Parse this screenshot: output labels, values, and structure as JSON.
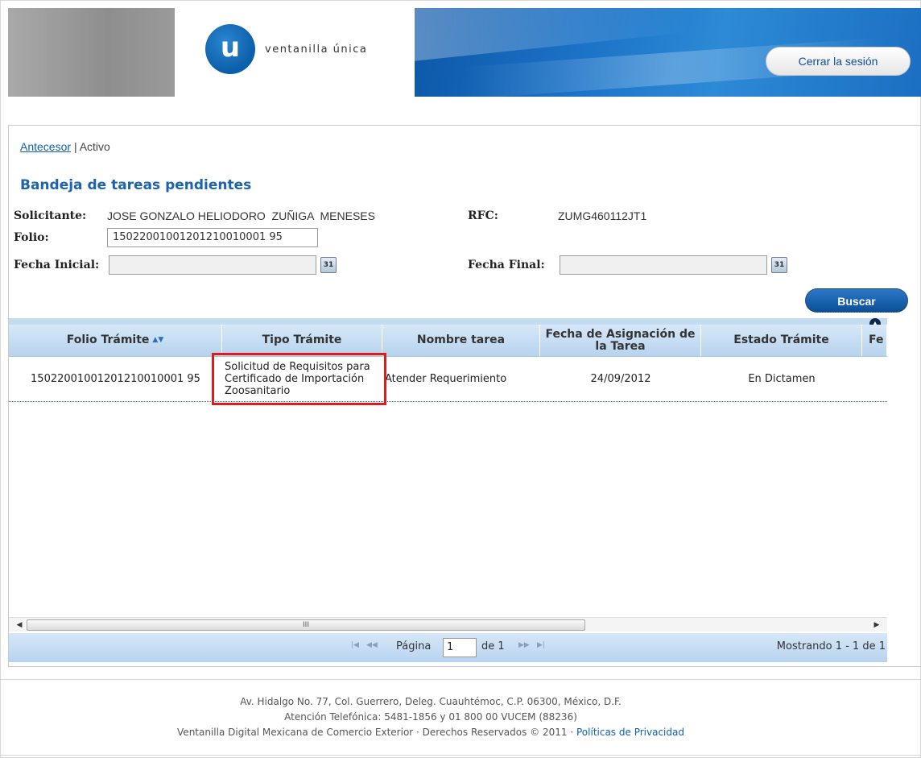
{
  "header": {
    "logo_letter": "u",
    "logo_text": "ventanilla única",
    "logout_label": "Cerrar la sesión"
  },
  "breadcrumb": {
    "link": "Antecesor",
    "separator": "|",
    "current": "Activo"
  },
  "page_title": "Bandeja de tareas pendientes",
  "form": {
    "solicitante_label": "Solicitante:",
    "solicitante_value": "JOSE GONZALO HELIODORO  ZUÑIGA  MENESES",
    "rfc_label": "RFC:",
    "rfc_value": "ZUMG460112JT1",
    "folio_label": "Folio:",
    "folio_value": "15022001001201210010001 95",
    "fecha_inicial_label": "Fecha Inicial:",
    "fecha_inicial_value": "",
    "fecha_final_label": "Fecha Final:",
    "fecha_final_value": "",
    "calendar_icon_text": "31",
    "search_label": "Buscar"
  },
  "grid": {
    "columns": [
      "Folio Trámite",
      "Tipo Trámite",
      "Nombre tarea",
      "Fecha de Asignación de la Tarea",
      "Estado Trámite",
      "Fe"
    ],
    "rows": [
      {
        "folio": "15022001001201210010001 95",
        "tipo": "Solicitud de Requisitos para Certificado de Importación Zoosanitario",
        "nombre": "Atender Requerimiento",
        "fecha": "24/09/2012",
        "estado": "En Dictamen"
      }
    ],
    "scroll_thumb_glyph": "III",
    "pager": {
      "page_label": "Página",
      "page_value": "1",
      "of_label": "de 1",
      "status": "Mostrando 1 - 1 de 1"
    }
  },
  "footer": {
    "line1": "Av. Hidalgo No. 77, Col. Guerrero, Deleg. Cuauhtémoc, C.P. 06300, México, D.F.",
    "line2": "Atención Telefónica: 5481-1856 y 01 800 00 VUCEM (88236)",
    "line3": "Ventanilla Digital Mexicana de Comercio Exterior · Derechos Reservados © 2011 ·",
    "privacy_link": "Políticas de Privacidad"
  },
  "colors": {
    "brand_blue": "#1b63ad",
    "highlight_red": "#e01b1b",
    "grid_header": "#c3dcf2"
  }
}
